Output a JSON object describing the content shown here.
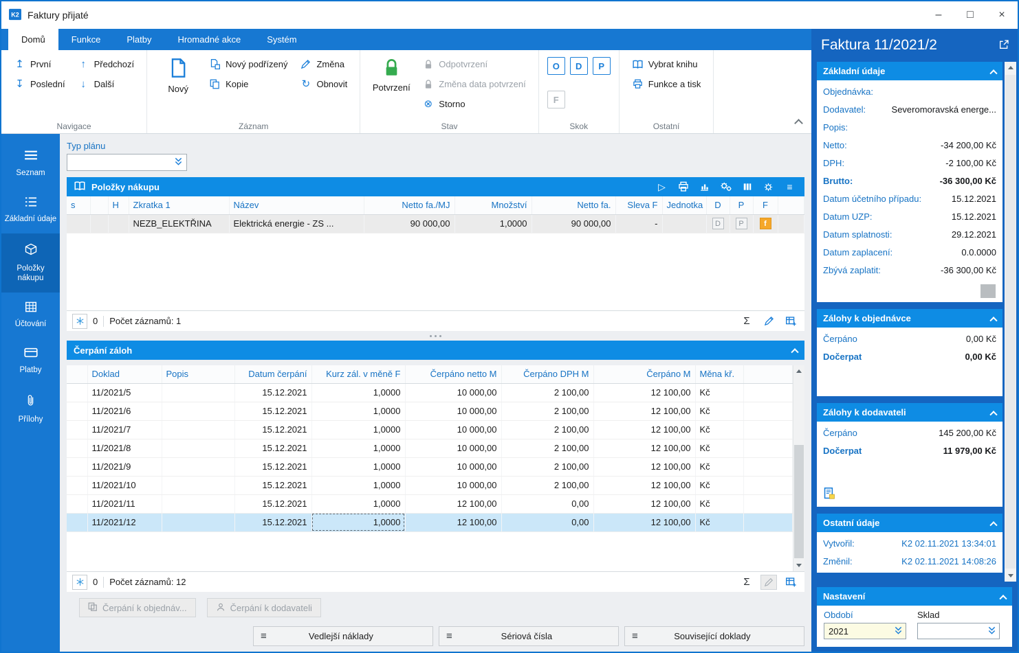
{
  "window": {
    "title": "Faktury přijaté"
  },
  "icons": {
    "minimize": "–",
    "maximize": "□",
    "close": "×",
    "first": "↥",
    "last": "↧",
    "prev": "↑",
    "next": "↓",
    "refresh": "↻",
    "storno": "⊗",
    "play": "▷",
    "menu": "≡",
    "sigma": "Σ"
  },
  "ribbon": {
    "tabs": [
      {
        "label": "Domů",
        "active": true
      },
      {
        "label": "Funkce"
      },
      {
        "label": "Platby"
      },
      {
        "label": "Hromadné akce"
      },
      {
        "label": "Systém"
      }
    ],
    "groups": {
      "navigace": {
        "label": "Navigace",
        "first": "První",
        "last": "Poslední",
        "prev": "Předchozí",
        "next": "Další"
      },
      "zaznam": {
        "label": "Záznam",
        "new": "Nový",
        "new_child": "Nový podřízený",
        "copy": "Kopie",
        "change": "Změna",
        "refresh": "Obnovit"
      },
      "stav": {
        "label": "Stav",
        "confirm": "Potvrzení",
        "unconfirm": "Odpotvrzení",
        "change_confirm_date": "Změna data potvrzení",
        "storno": "Storno"
      },
      "skok": {
        "label": "Skok",
        "buttons": [
          {
            "label": "O",
            "enabled": true
          },
          {
            "label": "D",
            "enabled": true
          },
          {
            "label": "P",
            "enabled": true
          },
          {
            "label": "F",
            "enabled": false
          }
        ]
      },
      "ostatni": {
        "label": "Ostatní",
        "select_book": "Vybrat knihu",
        "functions_print": "Funkce a tisk"
      }
    }
  },
  "sidebar": {
    "items": [
      {
        "label": "Seznam"
      },
      {
        "label": "Základní údaje"
      },
      {
        "label": "Položky nákupu",
        "active": true
      },
      {
        "label": "Účtování"
      },
      {
        "label": "Platby"
      },
      {
        "label": "Přílohy"
      }
    ]
  },
  "typ_planu": {
    "label": "Typ plánu",
    "value": ""
  },
  "purchase": {
    "title": "Položky nákupu",
    "columns": [
      {
        "label": "s",
        "align": "left"
      },
      {
        "label": "",
        "align": "left"
      },
      {
        "label": "H",
        "align": "left"
      },
      {
        "label": "Zkratka 1",
        "align": "left"
      },
      {
        "label": "Název",
        "align": "left"
      },
      {
        "label": "Netto fa./MJ",
        "align": "right"
      },
      {
        "label": "Množství",
        "align": "right"
      },
      {
        "label": "Netto fa.",
        "align": "right"
      },
      {
        "label": "Sleva F",
        "align": "right"
      },
      {
        "label": "Jednotka",
        "align": "left"
      },
      {
        "label": "D",
        "align": "center"
      },
      {
        "label": "P",
        "align": "center"
      },
      {
        "label": "F",
        "align": "center"
      }
    ],
    "row": [
      "",
      "",
      "",
      "NEZB_ELEKTŘINA",
      "Elektrická energie - ZS ...",
      "90 000,00",
      "1,0000",
      "90 000,00",
      "-",
      "",
      "D",
      "P",
      "f"
    ],
    "footer": {
      "flag_count": "0",
      "records": "Počet záznamů: 1"
    }
  },
  "advances": {
    "title": "Čerpání záloh",
    "columns": [
      {
        "label": "",
        "align": "left"
      },
      {
        "label": "Doklad",
        "align": "left"
      },
      {
        "label": "Popis",
        "align": "left"
      },
      {
        "label": "Datum čerpání",
        "align": "right"
      },
      {
        "label": "Kurz zál. v měně F",
        "align": "right"
      },
      {
        "label": "Čerpáno netto M",
        "align": "right"
      },
      {
        "label": "Čerpáno DPH M",
        "align": "right"
      },
      {
        "label": "Čerpáno M",
        "align": "right"
      },
      {
        "label": "Měna kř.",
        "align": "left"
      }
    ],
    "rows": [
      [
        "",
        "11/2021/5",
        "",
        "15.12.2021",
        "1,0000",
        "10 000,00",
        "2 100,00",
        "12 100,00",
        "Kč"
      ],
      [
        "",
        "11/2021/6",
        "",
        "15.12.2021",
        "1,0000",
        "10 000,00",
        "2 100,00",
        "12 100,00",
        "Kč"
      ],
      [
        "",
        "11/2021/7",
        "",
        "15.12.2021",
        "1,0000",
        "10 000,00",
        "2 100,00",
        "12 100,00",
        "Kč"
      ],
      [
        "",
        "11/2021/8",
        "",
        "15.12.2021",
        "1,0000",
        "10 000,00",
        "2 100,00",
        "12 100,00",
        "Kč"
      ],
      [
        "",
        "11/2021/9",
        "",
        "15.12.2021",
        "1,0000",
        "10 000,00",
        "2 100,00",
        "12 100,00",
        "Kč"
      ],
      [
        "",
        "11/2021/10",
        "",
        "15.12.2021",
        "1,0000",
        "10 000,00",
        "2 100,00",
        "12 100,00",
        "Kč"
      ],
      [
        "",
        "11/2021/11",
        "",
        "15.12.2021",
        "1,0000",
        "12 100,00",
        "0,00",
        "12 100,00",
        "Kč"
      ],
      [
        "",
        "11/2021/12",
        "",
        "15.12.2021",
        "1,0000",
        "12 100,00",
        "0,00",
        "12 100,00",
        "Kč"
      ]
    ],
    "selected_row": 7,
    "focused_col": 4,
    "footer": {
      "flag_count": "0",
      "records": "Počet záznamů: 12"
    },
    "action_buttons": [
      "Čerpání k objednáv...",
      "Čerpání k dodavateli"
    ]
  },
  "bottom_buttons": [
    "Vedlejší náklady",
    "Sériová čísla",
    "Související doklady"
  ],
  "detail": {
    "title": "Faktura 11/2021/2",
    "basic": {
      "title": "Základní údaje",
      "rows": [
        {
          "label": "Objednávka:",
          "value": ""
        },
        {
          "label": "Dodavatel:",
          "value": "Severomoravská energe..."
        },
        {
          "label": "Popis:",
          "value": ""
        },
        {
          "label": "Netto:",
          "value": "-34 200,00 Kč"
        },
        {
          "label": "DPH:",
          "value": "-2 100,00 Kč"
        },
        {
          "label": "Brutto:",
          "value": "-36 300,00 Kč",
          "bold": true
        },
        {
          "label": "Datum účetního případu:",
          "value": "15.12.2021"
        },
        {
          "label": "Datum UZP:",
          "value": "15.12.2021"
        },
        {
          "label": "Datum splatnosti:",
          "value": "29.12.2021"
        },
        {
          "label": "Datum zaplacení:",
          "value": "0.0.0000"
        },
        {
          "label": "Zbývá zaplatit:",
          "value": "-36 300,00 Kč"
        }
      ]
    },
    "advances_order": {
      "title": "Zálohy k objednávce",
      "rows": [
        {
          "label": "Čerpáno",
          "value": "0,00 Kč"
        },
        {
          "label": "Dočerpat",
          "value": "0,00 Kč",
          "bold": true
        }
      ]
    },
    "advances_supplier": {
      "title": "Zálohy k dodavateli",
      "rows": [
        {
          "label": "Čerpáno",
          "value": "145 200,00 Kč"
        },
        {
          "label": "Dočerpat",
          "value": "11 979,00 Kč",
          "bold": true
        }
      ]
    },
    "other": {
      "title": "Ostatní údaje",
      "rows": [
        {
          "label": "Vytvořil:",
          "value": "K2 02.11.2021 13:34:01"
        },
        {
          "label": "Změnil:",
          "value": "K2 02.11.2021 14:08:26"
        }
      ]
    },
    "settings": {
      "title": "Nastavení",
      "obdobi_label": "Období",
      "sklad_label": "Sklad",
      "obdobi_value": "2021",
      "sklad_value": ""
    }
  }
}
